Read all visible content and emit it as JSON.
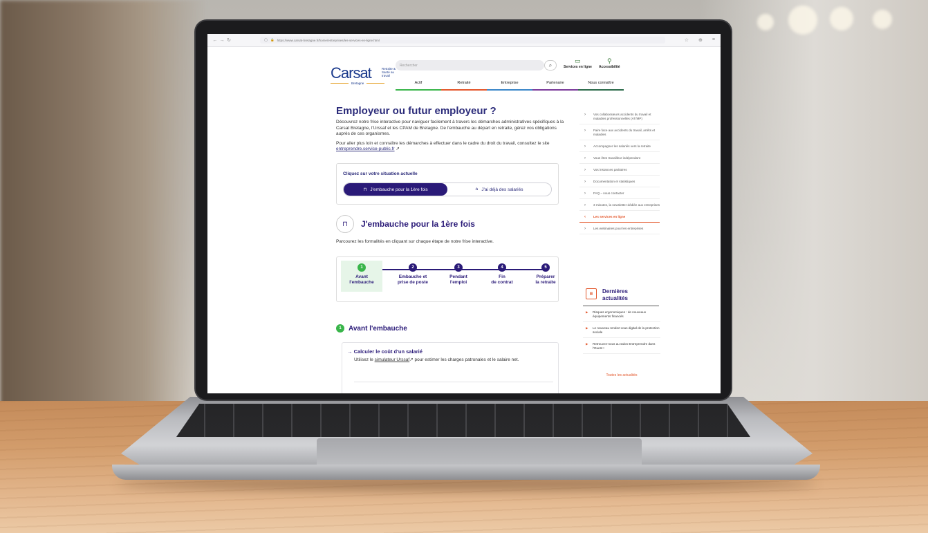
{
  "browser": {
    "url": "https://www.carsat-bretagne.fr/home/entreprises/les-services-en-ligne.html"
  },
  "header": {
    "logo_main": "Carsat",
    "logo_sub": "Retraite & Santé au travail",
    "logo_region": "Bretagne",
    "search_placeholder": "Rechercher",
    "online_services": "Services en ligne",
    "accessibility": "Accessibilité",
    "menu": [
      {
        "label": "Actif",
        "color": "#39b54a"
      },
      {
        "label": "Retraité",
        "color": "#e3562a"
      },
      {
        "label": "Entreprise",
        "color": "#3a86c8"
      },
      {
        "label": "Partenaire",
        "color": "#7a3a9a"
      },
      {
        "label": "Nous connaître",
        "color": "#2a6a4a"
      }
    ]
  },
  "main": {
    "title": "Employeur ou futur employeur ?",
    "intro": "Découvrez notre frise interactive pour naviguer facilement à travers les démarches administratives spécifiques à la Carsat Bretagne, l'Urssaf et les CPAM de Bretagne. De l'embauche au départ en retraite, gérez vos obligations auprès de ces organismes.",
    "more_prefix": "Pour aller plus loin et connaître les démarches à effectuer dans le cadre du droit du travail, consultez le site ",
    "more_link": "entreprendre.service-public.fr",
    "choice_title": "Cliquez sur votre situation actuelle",
    "choice_on": "J'embauche pour la 1ère fois",
    "choice_off": "J'ai déjà des salariés",
    "section_title": "J'embauche pour la 1ère fois",
    "section_sub": "Parcourez les formalités en cliquant sur chaque étape de notre frise interactive.",
    "steps": [
      {
        "num": "1",
        "l1": "Avant",
        "l2": "l'embauche"
      },
      {
        "num": "2",
        "l1": "Embauche et",
        "l2": "prise de poste"
      },
      {
        "num": "3",
        "l1": "Pendant",
        "l2": "l'emploi"
      },
      {
        "num": "4",
        "l1": "Fin",
        "l2": "de contrat"
      },
      {
        "num": "5",
        "l1": "Préparer",
        "l2": "la retraite"
      }
    ],
    "avant_num": "1",
    "avant_title": "Avant l'embauche",
    "card_title": "Calculer le coût d'un salarié",
    "card_prefix": "Utilisez le ",
    "card_link": "simulateur Urssaf",
    "card_suffix": " pour estimer les charges patronales et le salaire net."
  },
  "sidebar": {
    "items": [
      "Vos collaborateurs accidents du travail et maladies professionnelles (AT/MP)",
      "Faire face aux accidents du travail, arrêts et maladies",
      "Accompagner les salariés vers la retraite",
      "Vous êtes travailleur indépendant",
      "Vos instances paritaires",
      "Documentation et statistiques",
      "FAQ – nous contacter",
      "3 minutes, la newsletter dédiée aux entreprises",
      "Les services en ligne",
      "Les webinaires pour les entreprises"
    ],
    "active_index": 8,
    "news_icon": "calendar-icon",
    "news_title_1": "Dernières",
    "news_title_2": "actualités",
    "news": [
      "Risques ergonomiques : de nouveaux équipements financés",
      "Le nouveau rendez-vous digital de la protection sociale",
      "Retrouvez-nous au salon Entreprendre dans l'Ouest !"
    ],
    "news_all": "Toutes les actualités"
  }
}
